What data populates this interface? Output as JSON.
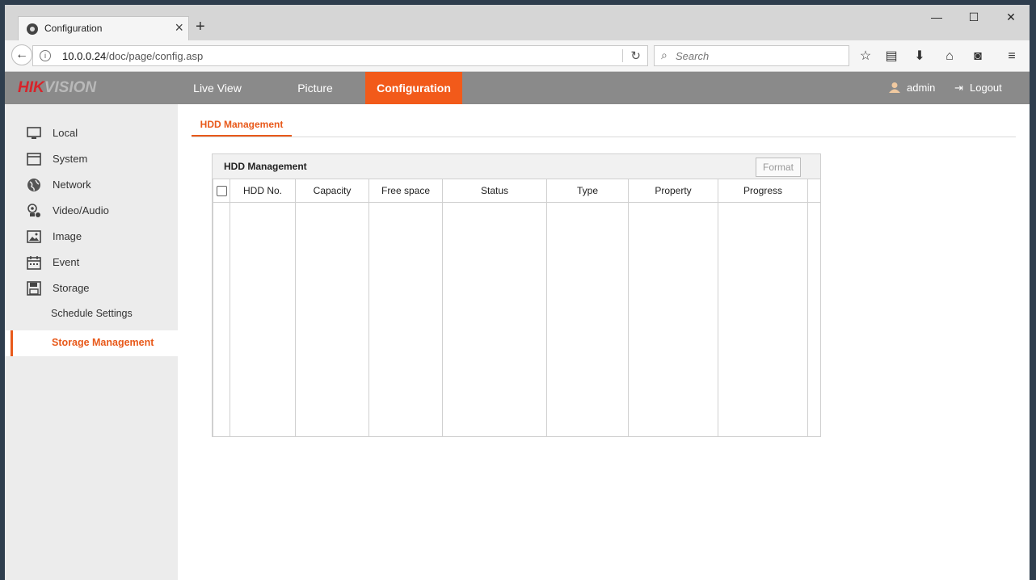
{
  "browser": {
    "tab_title": "Configuration",
    "url_host": "10.0.0.24",
    "url_path": "/doc/page/config.asp",
    "search_placeholder": "Search"
  },
  "app": {
    "logo_brand": "HIK",
    "logo_brand2": "VISION",
    "nav": [
      {
        "label": "Live View"
      },
      {
        "label": "Picture"
      },
      {
        "label": "Configuration"
      }
    ],
    "user": "admin",
    "logout": "Logout"
  },
  "sidebar": {
    "items": [
      {
        "label": "Local",
        "icon": "monitor-icon"
      },
      {
        "label": "System",
        "icon": "system-icon"
      },
      {
        "label": "Network",
        "icon": "globe-icon"
      },
      {
        "label": "Video/Audio",
        "icon": "video-audio-icon"
      },
      {
        "label": "Image",
        "icon": "image-icon"
      },
      {
        "label": "Event",
        "icon": "calendar-icon"
      },
      {
        "label": "Storage",
        "icon": "floppy-icon"
      }
    ],
    "subitems": [
      {
        "label": "Schedule Settings"
      },
      {
        "label": "Storage Management"
      }
    ]
  },
  "content": {
    "tab": "HDD Management",
    "panel_title": "HDD Management",
    "format_button": "Format",
    "columns": [
      "HDD No.",
      "Capacity",
      "Free space",
      "Status",
      "Type",
      "Property",
      "Progress"
    ]
  },
  "colors": {
    "accent": "#f25a1a",
    "header_bg": "#8a8a8a",
    "sidebar_bg": "#ececec"
  }
}
